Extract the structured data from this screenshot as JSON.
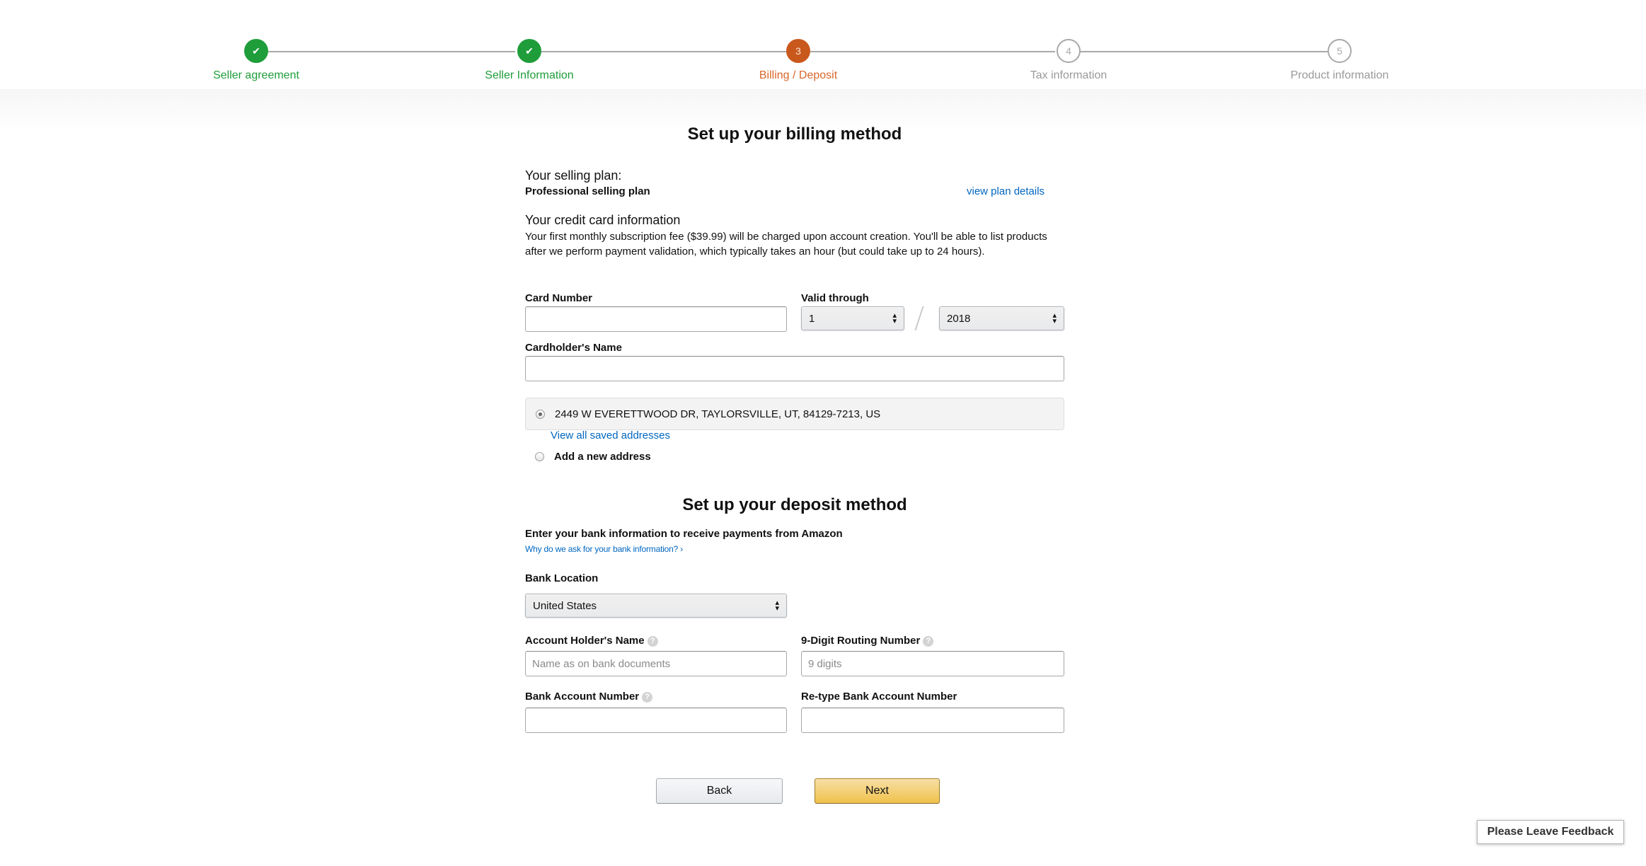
{
  "stepper": {
    "steps": [
      {
        "label": "Seller agreement",
        "status": "done",
        "number": "1"
      },
      {
        "label": "Seller Information",
        "status": "done",
        "number": "2"
      },
      {
        "label": "Billing / Deposit",
        "status": "current",
        "number": "3"
      },
      {
        "label": "Tax information",
        "status": "todo",
        "number": "4"
      },
      {
        "label": "Product information",
        "status": "todo",
        "number": "5"
      }
    ]
  },
  "billing": {
    "title": "Set up your billing method",
    "plan_label": "Your selling plan:",
    "plan_value": "Professional selling plan",
    "view_plan_link": "view plan details",
    "cc_heading": "Your credit card information",
    "cc_description": "Your first monthly subscription fee ($39.99) will be charged upon account creation. You'll be able to list products after we perform payment validation, which typically takes an hour (but could take up to 24 hours).",
    "card_number_label": "Card Number",
    "card_number_value": "",
    "valid_through_label": "Valid through",
    "month_value": "1",
    "year_value": "2018",
    "cardholder_label": "Cardholder's Name",
    "cardholder_value": "",
    "saved_address": "2449 W EVERETTWOOD DR, TAYLORSVILLE, UT, 84129-7213, US",
    "view_saved_link": "View all saved addresses",
    "add_address_label": "Add a new address"
  },
  "deposit": {
    "title": "Set up your deposit method",
    "intro": "Enter your bank information to receive payments from Amazon",
    "why_link": "Why do we ask for your bank information? ›",
    "bank_location_label": "Bank Location",
    "bank_location_value": "United States",
    "account_holder_label": "Account Holder's Name",
    "account_holder_placeholder": "Name as on bank documents",
    "routing_label": "9-Digit Routing Number",
    "routing_placeholder": "9 digits",
    "account_number_label": "Bank Account Number",
    "retype_label": "Re-type Bank Account Number"
  },
  "actions": {
    "back_label": "Back",
    "next_label": "Next"
  },
  "feedback_label": "Please Leave Feedback",
  "icons": {
    "check": "✔",
    "help": "?",
    "select_arrows": "⬍"
  },
  "colors": {
    "done": "#1f9d3a",
    "current": "#c9581d",
    "todo": "#a9a9a9",
    "link": "#0066c0",
    "primary_button": "#f0c14b"
  }
}
